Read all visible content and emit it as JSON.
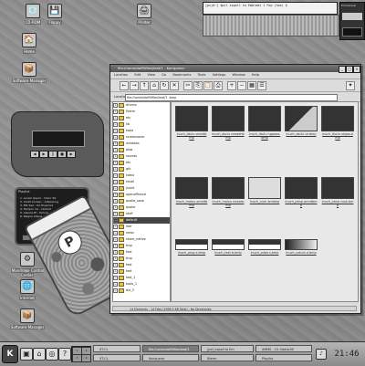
{
  "desktop": {
    "icons": [
      {
        "label": "CD-ROM",
        "glyph": "💿"
      },
      {
        "label": "Floppy",
        "glyph": "💾"
      },
      {
        "label": "Printer",
        "glyph": "🖨"
      },
      {
        "label": "Home",
        "glyph": "🏠"
      },
      {
        "label": "Software Manager",
        "glyph": "📦"
      },
      {
        "label": "Mandrake Control Center",
        "glyph": "⚙"
      },
      {
        "label": "Internet",
        "glyph": "🌐"
      },
      {
        "label": "Software Manager",
        "glyph": "📦"
      }
    ]
  },
  "terminal": {
    "text": "[pcjd~] $pcl xspoll to Emblem1 1 Fop (hxe) $"
  },
  "mini_app": {
    "title": "Emmanuel"
  },
  "file_manager": {
    "title": "file:/home/doffi/files/leaf/1 - Konqueror",
    "menu": [
      "Location",
      "Edit",
      "View",
      "Go",
      "Bookmarks",
      "Tools",
      "Settings",
      "Window",
      "Help"
    ],
    "location_label": "Location:",
    "location_value": "file:/home/doffi/files/leaf/1 .bmp",
    "tree": [
      {
        "label": "drivers",
        "selected": false
      },
      {
        "label": "Eterm",
        "selected": false
      },
      {
        "label": "etc",
        "selected": false
      },
      {
        "label": "lib",
        "selected": false
      },
      {
        "label": "tools",
        "selected": false
      },
      {
        "label": "screensaver",
        "selected": false
      },
      {
        "label": "windows",
        "selected": false
      },
      {
        "label": "ptsa",
        "selected": false
      },
      {
        "label": "sounds",
        "selected": false
      },
      {
        "label": "etc",
        "selected": false
      },
      {
        "label": "gtk",
        "selected": false
      },
      {
        "label": "kdeui",
        "selected": false
      },
      {
        "label": "kmail",
        "selected": false
      },
      {
        "label": "jscert",
        "selected": false
      },
      {
        "label": "openofficevd",
        "selected": false
      },
      {
        "label": "quake_save",
        "selected": false
      },
      {
        "label": "quake",
        "selected": false
      },
      {
        "label": "stuff",
        "selected": false
      },
      {
        "label": "default",
        "selected": true
      },
      {
        "label": "leaf",
        "selected": false
      },
      {
        "label": "news",
        "selected": false
      },
      {
        "label": "share_native",
        "selected": false
      },
      {
        "label": "tmp",
        "selected": false
      },
      {
        "label": "test",
        "selected": false
      },
      {
        "label": "tmp",
        "selected": false
      },
      {
        "label": "test",
        "selected": false
      },
      {
        "label": "test",
        "selected": false
      },
      {
        "label": "test_1",
        "selected": false
      },
      {
        "label": "tools_1",
        "selected": false
      },
      {
        "label": "bin_2",
        "selected": false
      }
    ],
    "files": [
      {
        "name": "lnuch_dsclu omnitbmp",
        "style": "dark"
      },
      {
        "name": "lnuch_dsclu neesehbmp",
        "style": "dark"
      },
      {
        "name": "lnuch_dsclu ngpooa.bmp",
        "style": "dark"
      },
      {
        "name": "lnuch_dsclu ut.bmp",
        "style": "diag"
      },
      {
        "name": "lnuch_dsclu utgoo.bmp",
        "style": "dark"
      },
      {
        "name": "lnuch_mainu omnitbmp",
        "style": "dark"
      },
      {
        "name": "lnuch_mainu neesebmp",
        "style": "dark"
      },
      {
        "name": "lnuch_num ambmp",
        "style": "light"
      },
      {
        "name": "lnuch_pbnp pmntbmp",
        "style": "dark"
      },
      {
        "name": "lnuch_pbnp noot.bmp",
        "style": "dark"
      },
      {
        "name": "lnuch_prog s.bmp",
        "style": "stripe"
      },
      {
        "name": "lnuch_test b.bmp",
        "style": "stripe"
      },
      {
        "name": "lnuch_vdeo s.bmp",
        "style": "stripe"
      },
      {
        "name": "lnuch_volum e.bmp",
        "style": "grad"
      }
    ],
    "status": "14 Elements - 14 Files (1999.3 KB Total) - No Directories"
  },
  "playlist": {
    "title": "Playlist",
    "items": [
      "1. Lorem Ipsum - Dolor Sit",
      "2. Amet Consec - Adipiscing",
      "3. Elit Sed - Do Eiusmod",
      "4. Tempor Inc - Ididunt",
      "5. Labore Et - Dolore",
      "6. Magna Aliqua - Ut Enim"
    ]
  },
  "taskbar": {
    "tasks": [
      {
        "label": "XT-CL",
        "active": false
      },
      {
        "label": "file:/home/doffi/files/leaf/1",
        "active": true
      },
      {
        "label": "[pcl] xspoll to Em",
        "active": false
      },
      {
        "label": "XMMS - 15. Nokia-Mi",
        "active": false
      },
      {
        "label": "XT-CL",
        "active": false
      },
      {
        "label": "Konqueror",
        "active": false
      },
      {
        "label": "Xterm",
        "active": false
      },
      {
        "label": "Playlist",
        "active": false
      }
    ],
    "pager": [
      "1",
      "2",
      "3",
      "4"
    ],
    "clock": "21:46"
  }
}
